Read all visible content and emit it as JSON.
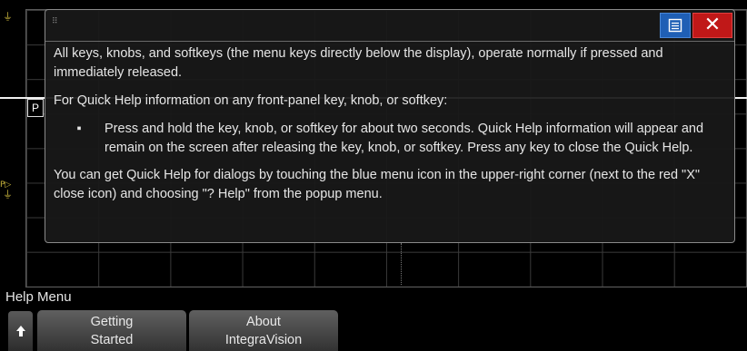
{
  "dialog": {
    "paragraph1": "All keys, knobs, and softkeys (the menu keys directly below the display), operate normally if pressed and immediately released.",
    "paragraph2": "For Quick Help information on any front-panel key, knob, or softkey:",
    "bullet_symbol": "▪",
    "bullet1": "Press and hold the key, knob, or softkey for about two seconds. Quick Help information will appear and remain on the screen after releasing the key, knob, or softkey. Press any key to close the Quick Help.",
    "paragraph3": "You can get Quick Help for dialogs by touching the blue menu icon in the upper-right corner (next to the red \"X\" close icon) and choosing \"? Help\" from the popup menu.",
    "drag_handle": "⠿",
    "close_glyph": "✕",
    "menu_icon": "menu-icon",
    "colors": {
      "menu": "#1f5fb5",
      "close": "#c01818"
    }
  },
  "scope": {
    "p_marker": "P",
    "ground_glyph": "⏚",
    "trig_glyph": "P▷"
  },
  "menu": {
    "title": "Help Menu",
    "up_icon": "up-arrow-icon",
    "softkeys": [
      {
        "line1": "Getting",
        "line2": "Started"
      },
      {
        "line1": "About",
        "line2": "IntegraVision"
      }
    ]
  }
}
